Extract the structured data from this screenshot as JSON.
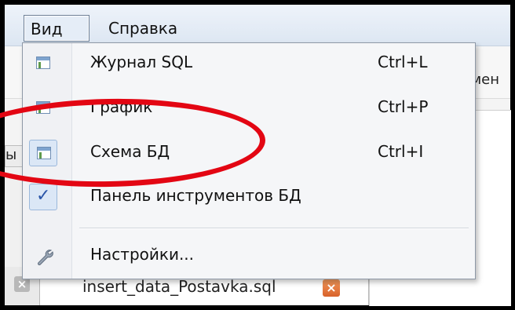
{
  "menubar": {
    "items": [
      {
        "label": "Вид"
      },
      {
        "label": "Справка"
      }
    ]
  },
  "background": {
    "right_text": "змен",
    "left_text": "ы",
    "tab": {
      "label": "insert_data_Postavka.sql",
      "close_glyph": "×",
      "inactive_close_glyph": "×"
    }
  },
  "dropdown": {
    "items": [
      {
        "label": "Журнал SQL",
        "shortcut": "Ctrl+L",
        "icon": "window-layout-icon"
      },
      {
        "label": "График",
        "shortcut": "Ctrl+P",
        "icon": "window-layout-icon"
      },
      {
        "label": "Схема БД",
        "shortcut": "Ctrl+I",
        "icon": "window-layout-icon",
        "checked": true
      },
      {
        "label": "Панель инструментов БД",
        "shortcut": "",
        "icon": "checkmark-icon",
        "checked": true
      },
      {
        "label": "Настройки...",
        "shortcut": "",
        "icon": "wrench-icon"
      }
    ],
    "check_glyph": "✓"
  },
  "annotation": {
    "color": "#e30613",
    "shape": "ellipse around Схема БД / График"
  }
}
